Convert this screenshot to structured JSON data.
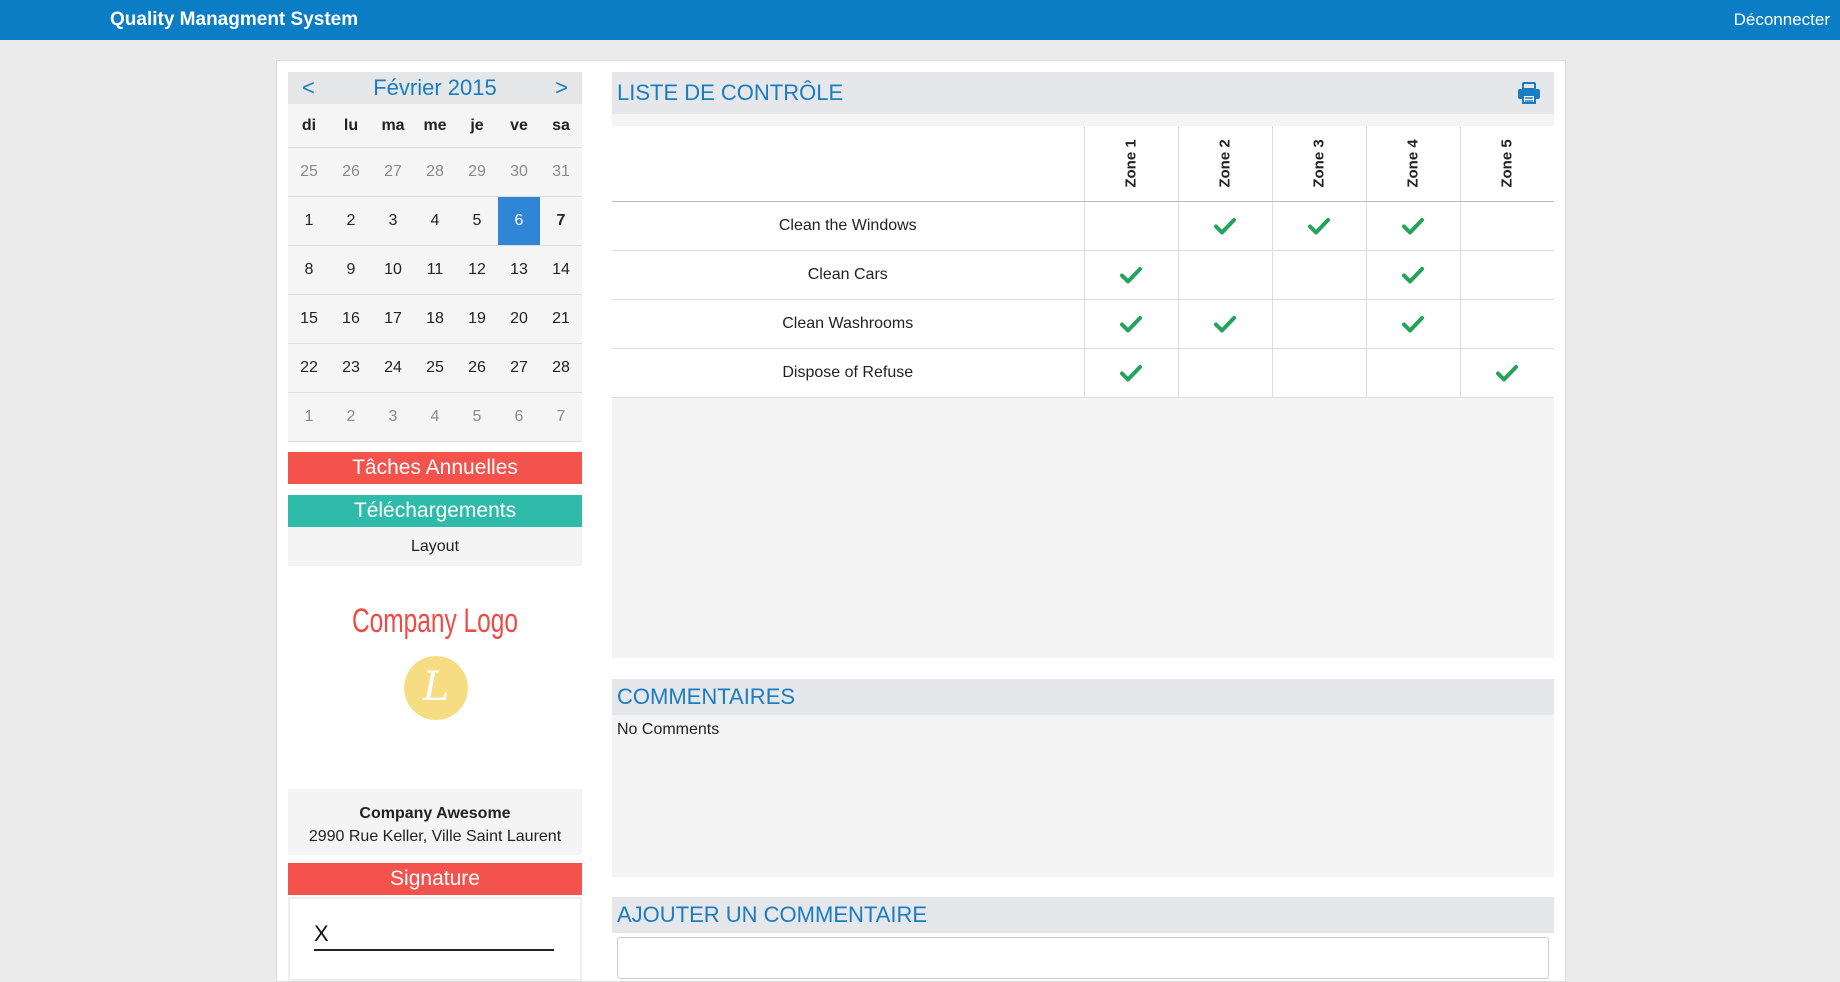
{
  "topbar": {
    "title": "Quality Managment System",
    "logout": "Déconnecter"
  },
  "calendar": {
    "prev": "<",
    "next": ">",
    "month_label": "Février 2015",
    "weekdays": [
      "di",
      "lu",
      "ma",
      "me",
      "je",
      "ve",
      "sa"
    ],
    "weeks": [
      [
        {
          "d": "25",
          "muted": true
        },
        {
          "d": "26",
          "muted": true
        },
        {
          "d": "27",
          "muted": true
        },
        {
          "d": "28",
          "muted": true
        },
        {
          "d": "29",
          "muted": true
        },
        {
          "d": "30",
          "muted": true
        },
        {
          "d": "31",
          "muted": true
        }
      ],
      [
        {
          "d": "1"
        },
        {
          "d": "2"
        },
        {
          "d": "3"
        },
        {
          "d": "4"
        },
        {
          "d": "5"
        },
        {
          "d": "6",
          "selected": true
        },
        {
          "d": "7",
          "bold": true
        }
      ],
      [
        {
          "d": "8"
        },
        {
          "d": "9"
        },
        {
          "d": "10"
        },
        {
          "d": "11"
        },
        {
          "d": "12"
        },
        {
          "d": "13"
        },
        {
          "d": "14"
        }
      ],
      [
        {
          "d": "15"
        },
        {
          "d": "16"
        },
        {
          "d": "17"
        },
        {
          "d": "18"
        },
        {
          "d": "19"
        },
        {
          "d": "20"
        },
        {
          "d": "21"
        }
      ],
      [
        {
          "d": "22"
        },
        {
          "d": "23"
        },
        {
          "d": "24"
        },
        {
          "d": "25"
        },
        {
          "d": "26"
        },
        {
          "d": "27"
        },
        {
          "d": "28"
        }
      ],
      [
        {
          "d": "1",
          "muted": true
        },
        {
          "d": "2",
          "muted": true
        },
        {
          "d": "3",
          "muted": true
        },
        {
          "d": "4",
          "muted": true
        },
        {
          "d": "5",
          "muted": true
        },
        {
          "d": "6",
          "muted": true
        },
        {
          "d": "7",
          "muted": true
        }
      ]
    ]
  },
  "sidebar": {
    "annual_tasks": "Tâches Annuelles",
    "downloads": "Téléchargements",
    "layout": "Layout",
    "logo_text": "Company Logo",
    "logo_letter": "L",
    "company_name": "Company Awesome",
    "company_address": "2990 Rue Keller, Ville Saint Laurent",
    "signature": "Signature",
    "signature_mark": "X"
  },
  "checklist": {
    "title": "LISTE DE CONTRÔLE",
    "print_icon": "printer-icon",
    "zones": [
      "Zone 1",
      "Zone 2",
      "Zone 3",
      "Zone 4",
      "Zone 5"
    ],
    "rows": [
      {
        "task": "Clean the Windows",
        "checks": [
          false,
          true,
          true,
          true,
          false
        ]
      },
      {
        "task": "Clean Cars",
        "checks": [
          true,
          false,
          false,
          true,
          false
        ]
      },
      {
        "task": "Clean Washrooms",
        "checks": [
          true,
          true,
          false,
          true,
          false
        ]
      },
      {
        "task": "Dispose of Refuse",
        "checks": [
          true,
          false,
          false,
          false,
          true
        ]
      }
    ],
    "check_color": "#22a45a"
  },
  "comments": {
    "title": "COMMENTAIRES",
    "body": "No Comments"
  },
  "add_comment": {
    "title": "AJOUTER UN COMMENTAIRE"
  },
  "colors": {
    "topbar": "#0a7dc4",
    "accent": "#1a7cc1",
    "red_button": "#f4524d",
    "teal_button": "#2fbbaa",
    "selected_day": "#2f86d6"
  }
}
